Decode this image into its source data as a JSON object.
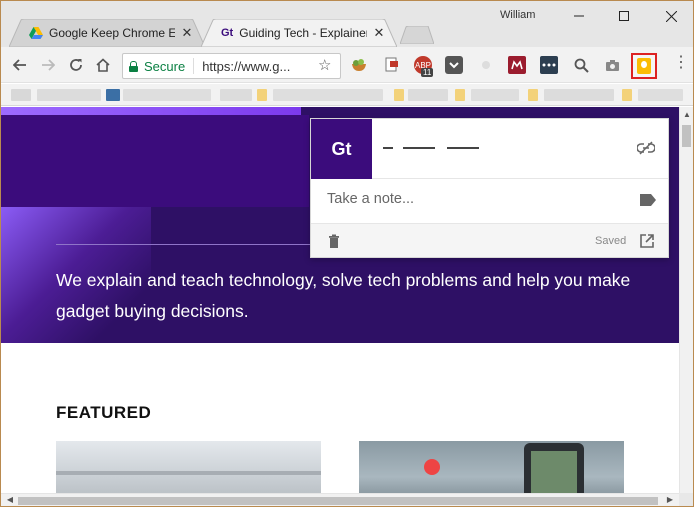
{
  "tabs": [
    {
      "title": "Google Keep Chrome Ext",
      "favicon": "google-drive-icon",
      "active": false
    },
    {
      "title": "Guiding Tech - Explainers",
      "favicon": "guiding-tech-icon",
      "active": true
    }
  ],
  "user": "William",
  "omnibox": {
    "secure_label": "Secure",
    "url": "https://www.g..."
  },
  "extensions": [
    {
      "name": "veggie-bowl-icon",
      "color": "#6d9e3a"
    },
    {
      "name": "pdf-icon",
      "color": "#c0392b"
    },
    {
      "name": "abp-icon",
      "label": "ABP",
      "badge": "11",
      "color": "#c0392b"
    },
    {
      "name": "pocket-icon",
      "color": "#555555"
    },
    {
      "name": "circle-icon",
      "color": "#dddddd"
    },
    {
      "name": "mendeley-icon",
      "color": "#9b1c2e"
    },
    {
      "name": "dots-icon",
      "color": "#2c3e50"
    },
    {
      "name": "search-icon",
      "color": "#555555"
    },
    {
      "name": "camera-icon",
      "color": "#777777"
    }
  ],
  "hero": {
    "text": "We explain and teach technology, solve tech problems and help you make gadget buying decisions."
  },
  "featured": "FEATURED",
  "keep_popup": {
    "logo": "Gt",
    "note_placeholder": "Take a note...",
    "status": "Saved"
  },
  "colors": {
    "hero_bg": "#2e1065",
    "brand_purple": "#3b0c7c",
    "secure_green": "#0b8043",
    "keep_yellow": "#fbbc04",
    "highlight_red": "#dd2222"
  }
}
